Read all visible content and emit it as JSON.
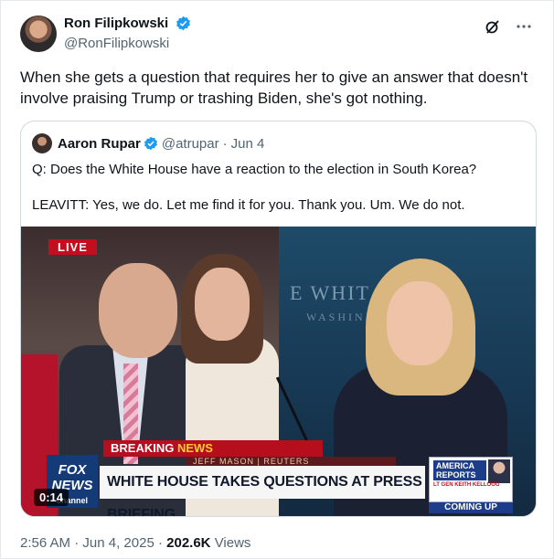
{
  "author": {
    "name": "Ron Filipkowski",
    "handle": "@RonFilipkowski",
    "verified": true
  },
  "tweet": {
    "text": "When she gets a question that requires her to give an answer that doesn't involve praising Trump or trashing Biden, she's got nothing."
  },
  "quoted": {
    "name": "Aaron Rupar",
    "handle": "@atrupar",
    "separator": "·",
    "date": "Jun 4",
    "line1": "Q: Does the White House have a reaction to the election in South Korea?",
    "line2": "LEAVITT: Yes, we do. Let me find it for you. Thank you. Um. We do not.",
    "video": {
      "duration": "0:14",
      "live_label": "LIVE",
      "breaking_label": "BREAKING",
      "breaking_news": "NEWS",
      "reporter": "JEFF MASON | REUTERS",
      "headline": "WHITE HOUSE TAKES QUESTIONS AT PRESS BRIEFING",
      "wh_text": "E WHIT",
      "wh_sub": "WASHIN",
      "network_logo": "FOX NEWS",
      "network_sub": "channel",
      "show_name": "AMERICA REPORTS",
      "guest_caption": "LT GEN KEITH KELLOGG",
      "coming_up": "COMING UP"
    }
  },
  "meta": {
    "time": "2:56 AM",
    "dot1": "·",
    "date": "Jun 4, 2025",
    "dot2": "·",
    "views_count": "202.6K",
    "views_label": "Views"
  },
  "colors": {
    "verified": "#1d9bf0",
    "secondary_text": "#536471",
    "border": "#cfd9de"
  },
  "icons": [
    "verified-badge-icon",
    "grok-icon",
    "more-icon"
  ]
}
